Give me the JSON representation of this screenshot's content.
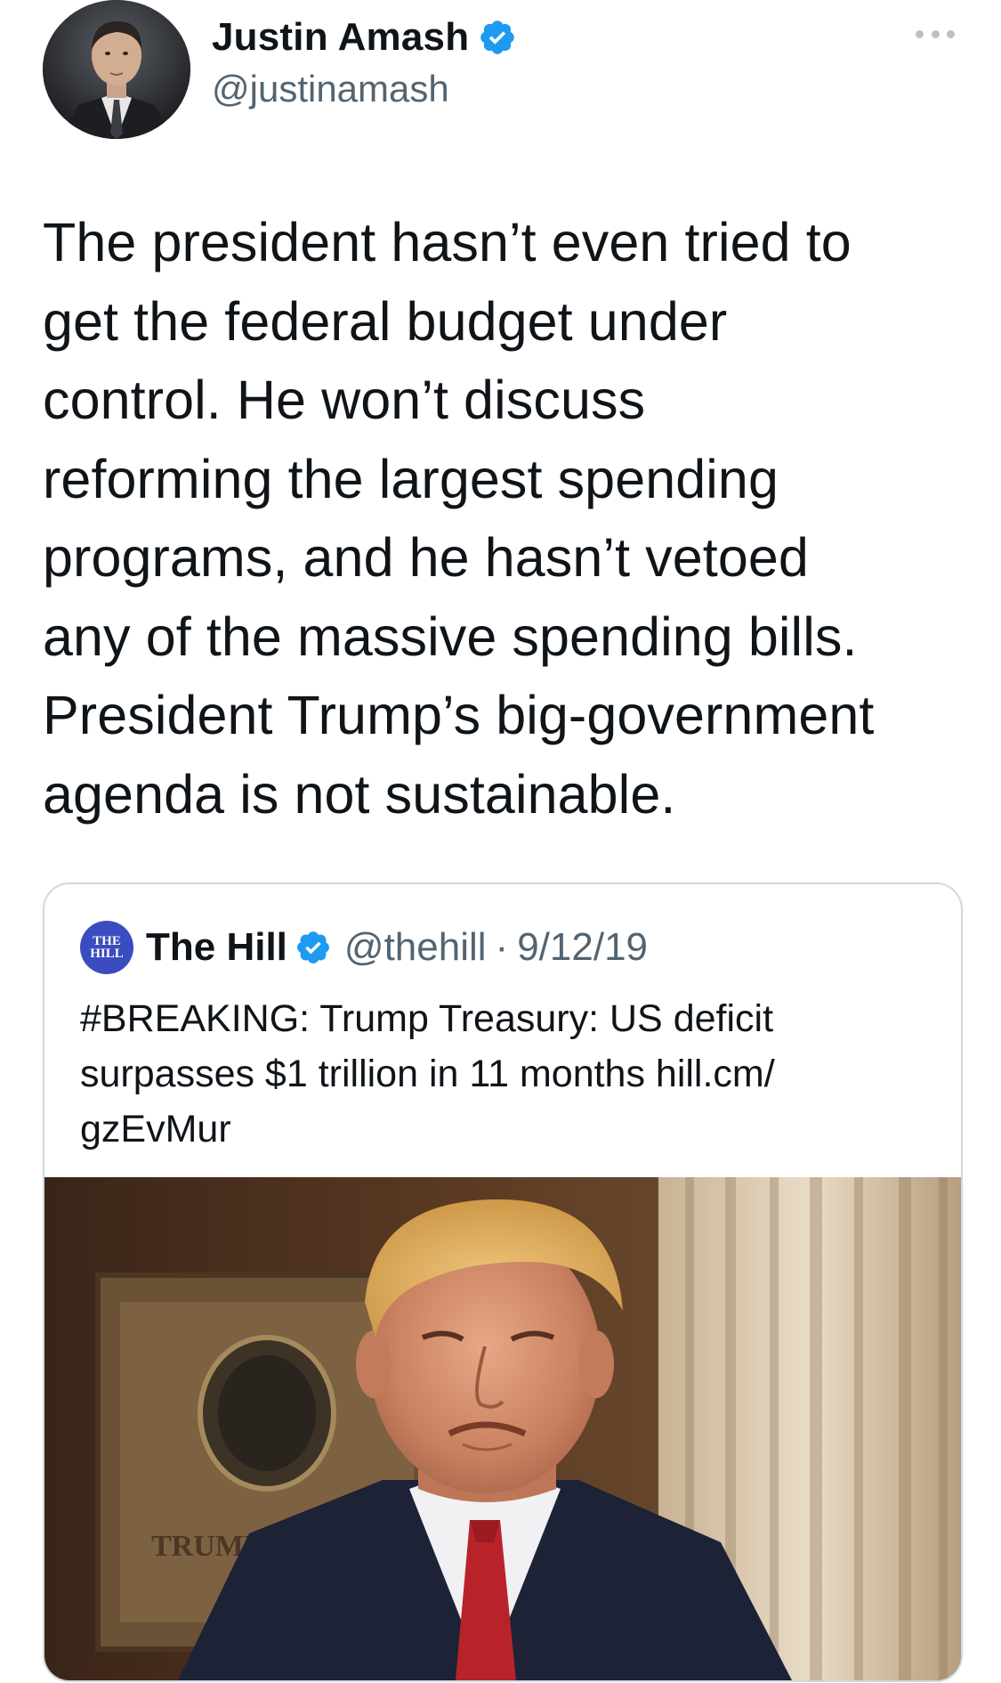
{
  "tweet": {
    "author": {
      "name": "Justin Amash",
      "handle": "@justinamash",
      "verified_icon": "verified-badge-icon",
      "avatar": "profile-photo"
    },
    "more_icon": "more-options-icon",
    "text": "The president hasn’t even tried to\nget the federal budget under\ncontrol. He won’t discuss\nreforming the largest spending\nprograms, and he hasn’t vetoed\nany of the massive spending bills.\nPresident Trump’s big-government\nagenda is not sustainable."
  },
  "quote": {
    "logo_text_line1": "THE",
    "logo_text_line2": "HILL",
    "name": "The Hill",
    "handle": "@thehill",
    "separator": "·",
    "date": "9/12/19",
    "text": "#BREAKING: Trump Treasury: US deficit\nsurpasses $1 trillion in 11 months hill.cm/\ngzEvMur",
    "image": "news-photo",
    "image_sign_text": "TRUMP TO"
  },
  "colors": {
    "accent": "#1d9bf0",
    "secondary_text": "#536471",
    "border": "#cfd9de",
    "hill_blue": "#3b4cc0"
  }
}
